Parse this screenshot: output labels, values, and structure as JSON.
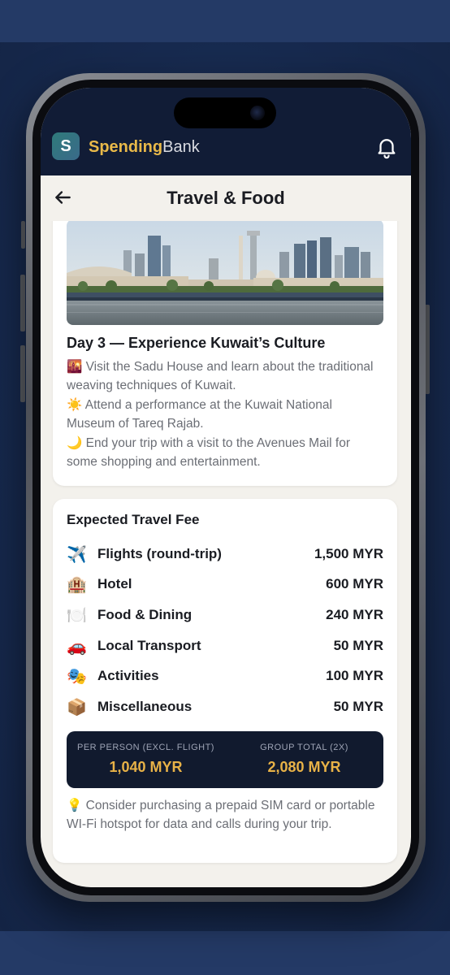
{
  "app": {
    "logo_letter": "S",
    "brand_bold": "Spending",
    "brand_light": "Bank",
    "icons": {
      "notifications": "bell-icon",
      "back": "arrow-left-icon"
    }
  },
  "nav": {
    "title": "Travel & Food"
  },
  "itinerary": {
    "day_title": "Day 3 — Experience Kuwait’s Culture",
    "items": [
      {
        "emoji": "🌇",
        "text": "Visit the Sadu House and learn about the traditional weaving techniques of Kuwait."
      },
      {
        "emoji": "☀️",
        "text": "Attend a performance at the Kuwait National Museum of Tareq Rajab."
      },
      {
        "emoji": "🌙",
        "text": "End your trip with a visit to the Avenues Mail for some shopping and entertainment."
      }
    ]
  },
  "fees": {
    "title": "Expected Travel Fee",
    "rows": [
      {
        "emoji": "✈️",
        "label": "Flights (round-trip)",
        "value": "1,500 MYR"
      },
      {
        "emoji": "🏨",
        "label": "Hotel",
        "value": "600 MYR"
      },
      {
        "emoji": "🍽️",
        "label": "Food & Dining",
        "value": "240 MYR"
      },
      {
        "emoji": "🚗",
        "label": "Local Transport",
        "value": "50 MYR"
      },
      {
        "emoji": "🎭",
        "label": "Activities",
        "value": "100 MYR"
      },
      {
        "emoji": "📦",
        "label": "Miscellaneous",
        "value": "50 MYR"
      }
    ],
    "per_person_label": "PER PERSON (EXCL. FLIGHT)",
    "per_person_value": "1,040 MYR",
    "group_label": "GROUP TOTAL (2X)",
    "group_value": "2,080 MYR",
    "tip_emoji": "💡",
    "tip": "Consider purchasing a prepaid SIM card or portable WI-Fi hotspot for data and calls during your trip."
  },
  "colors": {
    "accent_gold": "#e9b949",
    "header_navy": "#111c36",
    "total_box": "#111a2e",
    "background": "#1a2c52"
  }
}
